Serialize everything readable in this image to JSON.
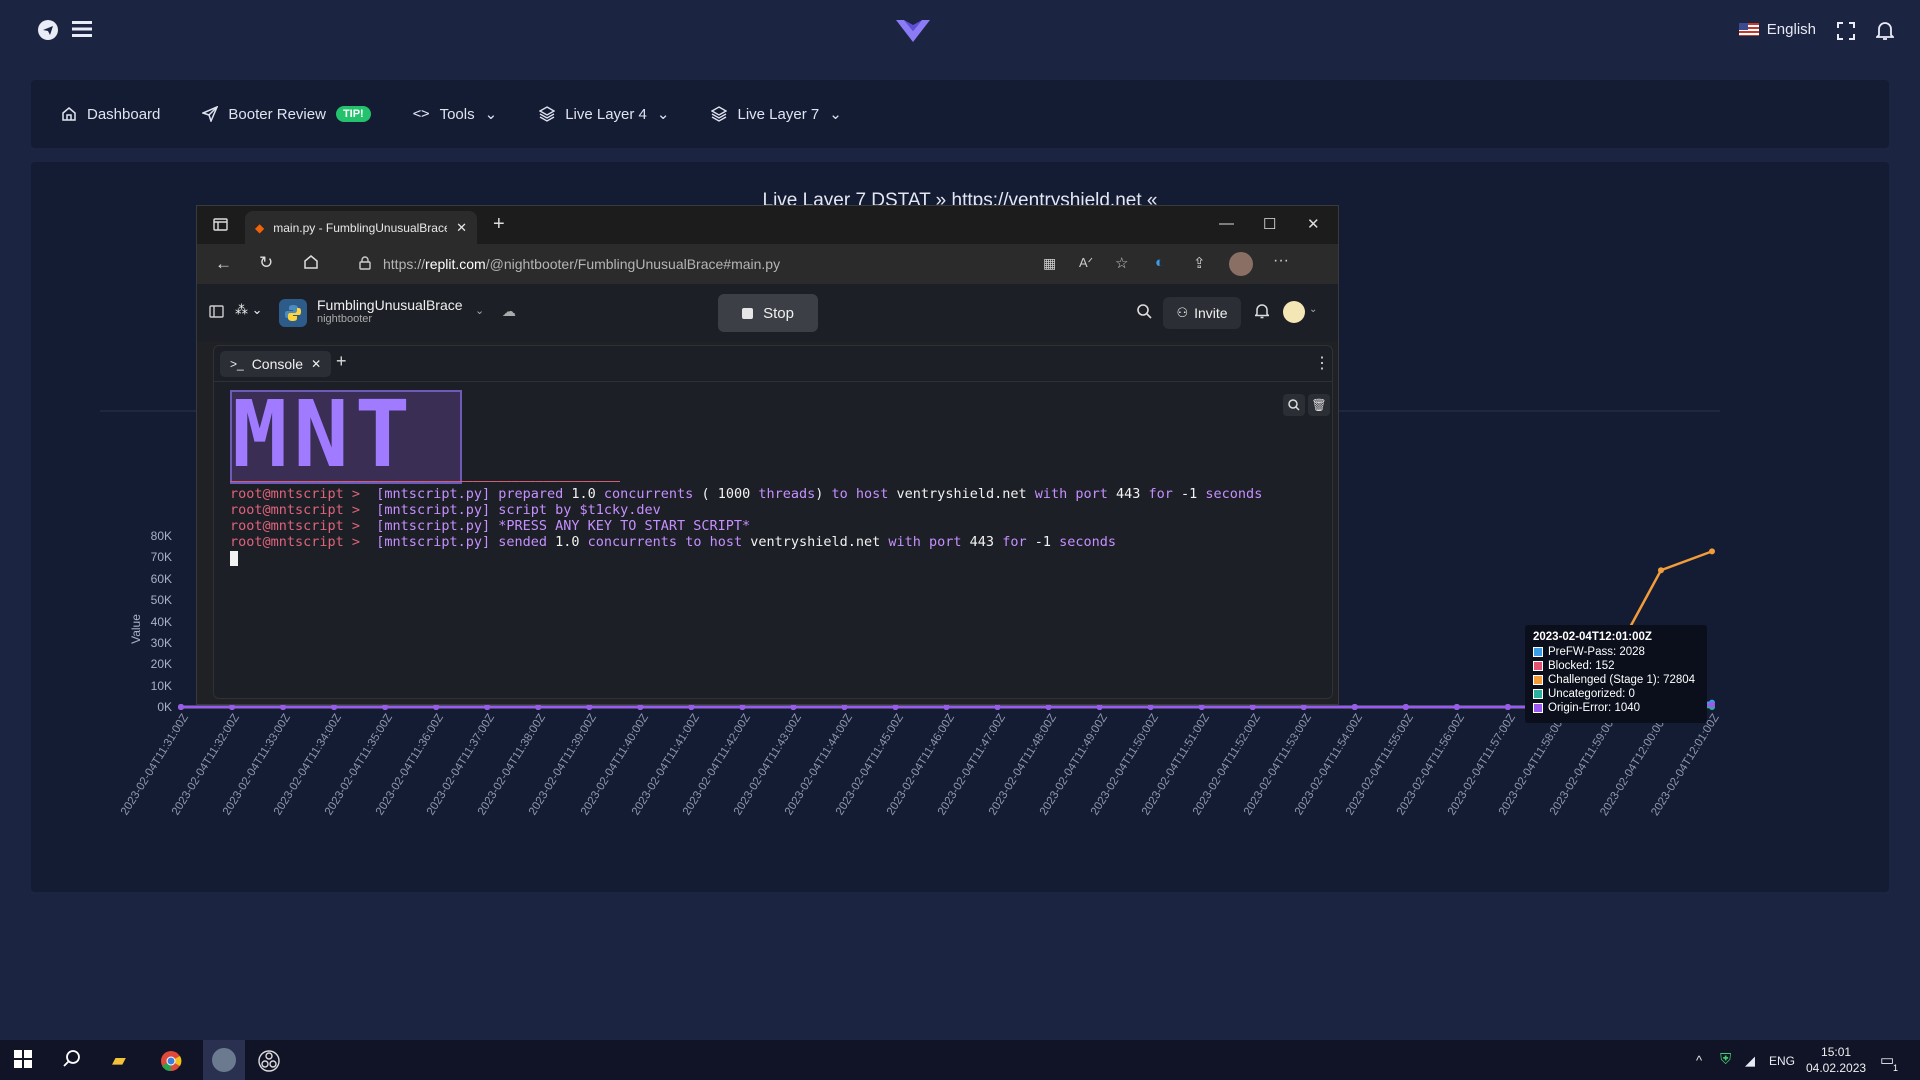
{
  "header": {
    "language": "English",
    "icons": [
      "telegram-icon",
      "menu-icon",
      "fullscreen-icon",
      "bell-icon"
    ]
  },
  "nav": [
    {
      "label": "Dashboard",
      "icon": "home-icon"
    },
    {
      "label": "Booter Review",
      "icon": "send-icon",
      "badge": "TIP!"
    },
    {
      "label": "Tools",
      "icon": "code-icon"
    },
    {
      "label": "Live Layer 4",
      "icon": "layers-icon"
    },
    {
      "label": "Live Layer 7",
      "icon": "layers-icon"
    }
  ],
  "chart_data": {
    "type": "line",
    "title": "Live Layer 7 DSTAT » https://ventryshield.net «",
    "ylabel": "Value",
    "yticks": [
      "80K",
      "70K",
      "60K",
      "50K",
      "40K",
      "30K",
      "20K",
      "10K",
      "0K"
    ],
    "ylim": [
      0,
      80000
    ],
    "x": [
      "2023-02-04T11:31:00Z",
      "2023-02-04T11:32:00Z",
      "2023-02-04T11:33:00Z",
      "2023-02-04T11:34:00Z",
      "2023-02-04T11:35:00Z",
      "2023-02-04T11:36:00Z",
      "2023-02-04T11:37:00Z",
      "2023-02-04T11:38:00Z",
      "2023-02-04T11:39:00Z",
      "2023-02-04T11:40:00Z",
      "2023-02-04T11:41:00Z",
      "2023-02-04T11:42:00Z",
      "2023-02-04T11:43:00Z",
      "2023-02-04T11:44:00Z",
      "2023-02-04T11:45:00Z",
      "2023-02-04T11:46:00Z",
      "2023-02-04T11:47:00Z",
      "2023-02-04T11:48:00Z",
      "2023-02-04T11:49:00Z",
      "2023-02-04T11:50:00Z",
      "2023-02-04T11:51:00Z",
      "2023-02-04T11:52:00Z",
      "2023-02-04T11:53:00Z",
      "2023-02-04T11:54:00Z",
      "2023-02-04T11:55:00Z",
      "2023-02-04T11:56:00Z",
      "2023-02-04T11:57:00Z",
      "2023-02-04T11:58:00Z",
      "2023-02-04T11:59:00Z",
      "2023-02-04T12:00:00Z",
      "2023-02-04T12:01:00Z"
    ],
    "series": [
      {
        "name": "PreFW-Pass",
        "color": "#3a9de8",
        "values": [
          0,
          0,
          0,
          0,
          0,
          0,
          0,
          0,
          0,
          0,
          0,
          0,
          0,
          0,
          0,
          0,
          0,
          0,
          0,
          0,
          0,
          0,
          0,
          0,
          0,
          0,
          0,
          0,
          0,
          800,
          2028
        ]
      },
      {
        "name": "Blocked",
        "color": "#e05470",
        "values": [
          0,
          0,
          0,
          0,
          0,
          0,
          0,
          0,
          0,
          0,
          0,
          0,
          0,
          0,
          0,
          0,
          0,
          0,
          0,
          0,
          0,
          0,
          0,
          0,
          0,
          0,
          0,
          0,
          0,
          0,
          152
        ]
      },
      {
        "name": "Challenged (Stage 1)",
        "color": "#f39c3a",
        "values": [
          0,
          0,
          0,
          0,
          0,
          0,
          0,
          0,
          0,
          0,
          0,
          0,
          0,
          0,
          0,
          0,
          0,
          0,
          0,
          0,
          0,
          0,
          0,
          0,
          0,
          0,
          0,
          0,
          20000,
          64000,
          72804
        ]
      },
      {
        "name": "Uncategorized",
        "color": "#2bb0a0",
        "values": [
          0,
          0,
          0,
          0,
          0,
          0,
          0,
          0,
          0,
          0,
          0,
          0,
          0,
          0,
          0,
          0,
          0,
          0,
          0,
          0,
          0,
          0,
          0,
          0,
          0,
          0,
          0,
          0,
          0,
          0,
          0
        ]
      },
      {
        "name": "Origin-Error",
        "color": "#9b59f0",
        "values": [
          0,
          0,
          0,
          0,
          0,
          0,
          0,
          0,
          0,
          0,
          0,
          0,
          0,
          0,
          0,
          0,
          0,
          0,
          0,
          0,
          0,
          0,
          0,
          0,
          0,
          0,
          0,
          0,
          0,
          0,
          1040
        ]
      }
    ],
    "tooltip": {
      "title": "2023-02-04T12:01:00Z",
      "rows": [
        "PreFW-Pass: 2028",
        "Blocked: 152",
        "Challenged (Stage 1): 72804",
        "Uncategorized: 0",
        "Origin-Error: 1040"
      ]
    }
  },
  "browser": {
    "tab_title": "main.py - FumblingUnusualBrace",
    "url_prefix": "https://",
    "url_domain": "replit.com",
    "url_path": "/@nightbooter/FumblingUnusualBrace#main.py"
  },
  "replit": {
    "project": "FumblingUnusualBrace",
    "owner": "nightbooter",
    "stop_label": "Stop",
    "invite_label": "Invite",
    "console_tab": "Console",
    "ascii_logo": "MNT",
    "divider": "———————————————————————————————————————————————————",
    "lines": [
      [
        [
          "p",
          "root@mntscript > "
        ],
        [
          "c",
          " [mntscript.py] "
        ],
        [
          "c",
          "prepared "
        ],
        [
          "w",
          "1.0 "
        ],
        [
          "c",
          "concurrents "
        ],
        [
          "w",
          "( 1000 "
        ],
        [
          "c",
          "threads"
        ],
        [
          "w",
          ") "
        ],
        [
          "c",
          "to host "
        ],
        [
          "w",
          "ventryshield.net "
        ],
        [
          "c",
          "with port "
        ],
        [
          "w",
          "443 "
        ],
        [
          "c",
          "for "
        ],
        [
          "w",
          "-1 "
        ],
        [
          "c",
          "seconds"
        ]
      ],
      [
        [
          "p",
          "root@mntscript > "
        ],
        [
          "c",
          " [mntscript.py] "
        ],
        [
          "c",
          "script by $t1cky.dev"
        ]
      ],
      [
        [
          "p",
          "root@mntscript > "
        ],
        [
          "c",
          " [mntscript.py] "
        ],
        [
          "c",
          "*PRESS ANY KEY TO START SCRIPT*"
        ]
      ],
      [
        [
          "p",
          "root@mntscript > "
        ],
        [
          "c",
          " [mntscript.py] "
        ],
        [
          "c",
          "sended "
        ],
        [
          "w",
          "1.0 "
        ],
        [
          "c",
          "concurrents "
        ],
        [
          "c",
          "to host "
        ],
        [
          "w",
          "ventryshield.net "
        ],
        [
          "c",
          "with port "
        ],
        [
          "w",
          "443 "
        ],
        [
          "c",
          "for "
        ],
        [
          "w",
          "-1 "
        ],
        [
          "c",
          "seconds"
        ]
      ]
    ]
  },
  "taskbar": {
    "lang": "ENG",
    "time": "15:01",
    "date": "04.02.2023",
    "notif_count": "1"
  }
}
